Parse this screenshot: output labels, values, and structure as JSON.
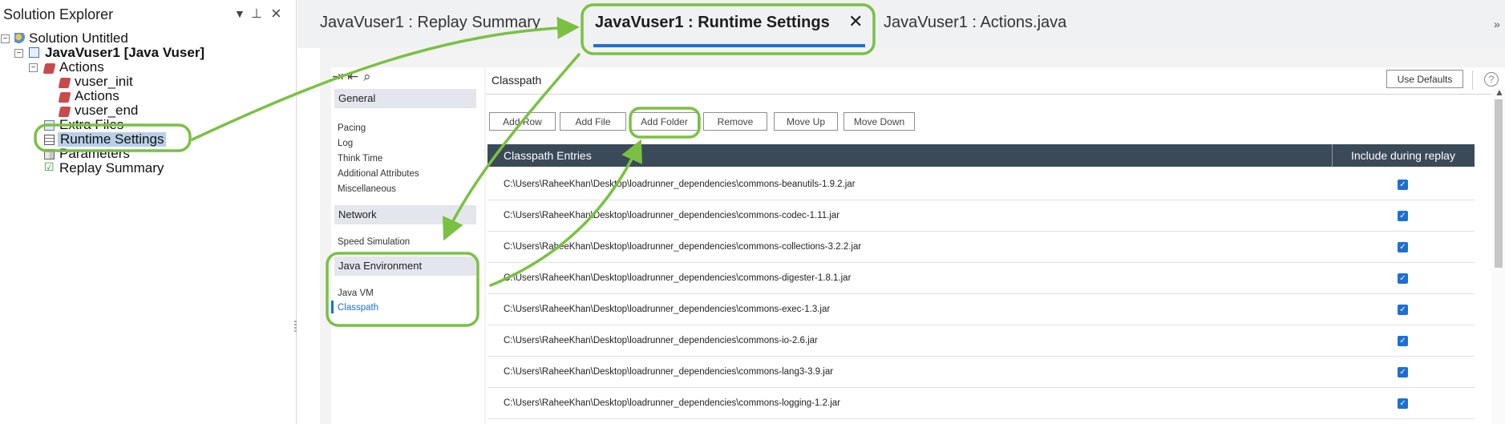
{
  "solution_explorer": {
    "title": "Solution Explorer",
    "tree": {
      "solution": "Solution Untitled",
      "project": "JavaVuser1 [Java Vuser]",
      "actions_folder": "Actions",
      "vuser_init": "vuser_init",
      "actions": "Actions",
      "vuser_end": "vuser_end",
      "extra_files": "Extra Files",
      "runtime_settings": "Runtime Settings",
      "parameters": "Parameters",
      "replay_summary": "Replay Summary"
    }
  },
  "tabs": {
    "replay": "JavaVuser1 : Replay Summary",
    "runtime": "JavaVuser1 : Runtime Settings",
    "actions": "JavaVuser1 : Actions.java"
  },
  "left_panel": {
    "general": "General",
    "general_items": [
      "Pacing",
      "Log",
      "Think Time",
      "Additional Attributes",
      "Miscellaneous"
    ],
    "network": "Network",
    "network_items": [
      "Speed Simulation"
    ],
    "java_env": "Java Environment",
    "java_items": [
      "Java VM",
      "Classpath"
    ]
  },
  "right_panel": {
    "title": "Classpath",
    "use_defaults": "Use Defaults",
    "buttons": {
      "add_row": "Add Row",
      "add_file": "Add File",
      "add_folder": "Add Folder",
      "remove": "Remove",
      "move_up": "Move Up",
      "move_down": "Move Down"
    },
    "table": {
      "col1": "Classpath Entries",
      "col2": "Include during replay",
      "rows": [
        "C:\\Users\\RaheeKhan\\Desktop\\loadrunner_dependencies\\commons-beanutils-1.9.2.jar",
        "C:\\Users\\RaheeKhan\\Desktop\\loadrunner_dependencies\\commons-codec-1.11.jar",
        "C:\\Users\\RaheeKhan\\Desktop\\loadrunner_dependencies\\commons-collections-3.2.2.jar",
        "C:\\Users\\RaheeKhan\\Desktop\\loadrunner_dependencies\\commons-digester-1.8.1.jar",
        "C:\\Users\\RaheeKhan\\Desktop\\loadrunner_dependencies\\commons-exec-1.3.jar",
        "C:\\Users\\RaheeKhan\\Desktop\\loadrunner_dependencies\\commons-io-2.6.jar",
        "C:\\Users\\RaheeKhan\\Desktop\\loadrunner_dependencies\\commons-lang3-3.9.jar",
        "C:\\Users\\RaheeKhan\\Desktop\\loadrunner_dependencies\\commons-logging-1.2.jar"
      ]
    }
  },
  "colors": {
    "accent": "#1f6fd1",
    "annotation": "#7ac143",
    "table_header": "#3b4a59"
  }
}
